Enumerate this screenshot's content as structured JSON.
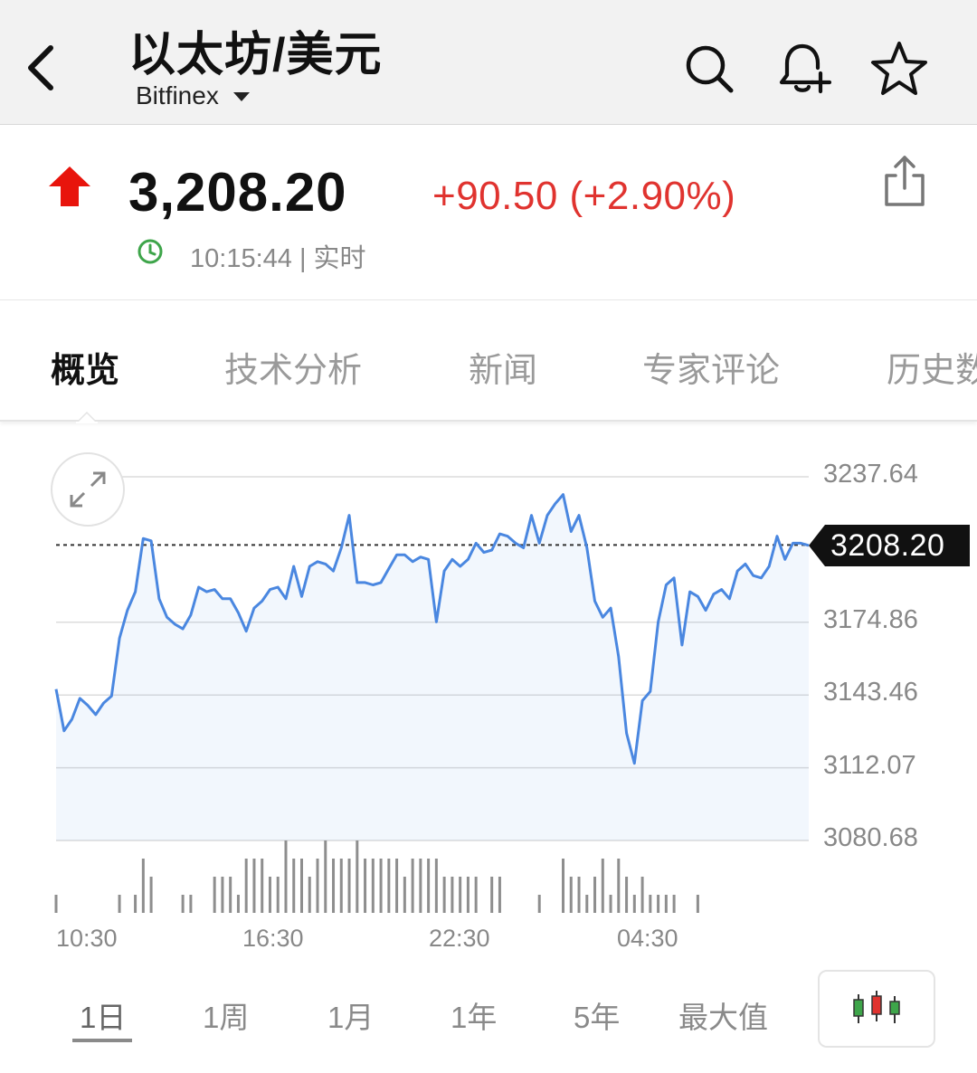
{
  "header": {
    "title": "以太坊/美元",
    "exchange": "Bitfinex",
    "icons": [
      "back-chevron-icon",
      "search-icon",
      "bell-plus-icon",
      "star-icon"
    ]
  },
  "quote": {
    "price": "3,208.20",
    "change": "+90.50 (+2.90%)",
    "time": "10:15:44 | 实时",
    "direction": "up",
    "up_color": "#e0332f",
    "clock_color": "#3ea54a"
  },
  "tabs": [
    "概览",
    "技术分析",
    "新闻",
    "专家评论",
    "历史数据"
  ],
  "chart": {
    "y_labels": [
      "3237.64",
      "3174.86",
      "3143.46",
      "3112.07",
      "3080.68"
    ],
    "x_labels": [
      "10:30",
      "16:30",
      "22:30",
      "04:30"
    ],
    "current_price_tag": "3208.20",
    "line_color": "#4a87e0"
  },
  "chart_data": {
    "type": "line",
    "x_ticks": [
      "10:30",
      "16:30",
      "22:30",
      "04:30"
    ],
    "ylim": [
      3080.68,
      3237.64
    ],
    "y_ticks": [
      3237.64,
      3206.25,
      3174.86,
      3143.46,
      3112.07,
      3080.68
    ],
    "current": 3208.2,
    "series": [
      {
        "values": [
          3146,
          3128,
          3133,
          3142,
          3139,
          3135,
          3140,
          3143,
          3168,
          3180,
          3188,
          3211,
          3210,
          3185,
          3177,
          3174,
          3172,
          3178,
          3190,
          3188,
          3189,
          3185,
          3185,
          3179,
          3171,
          3181,
          3184,
          3189,
          3190,
          3185,
          3199,
          3186,
          3199,
          3201,
          3200,
          3197,
          3207,
          3221,
          3192,
          3192,
          3191,
          3192,
          3198,
          3204,
          3204,
          3201,
          3203,
          3202,
          3175,
          3197,
          3202,
          3199,
          3202,
          3209,
          3205,
          3206,
          3213,
          3212,
          3209,
          3207,
          3221,
          3209,
          3221,
          3226,
          3230,
          3214,
          3221,
          3207,
          3184,
          3177,
          3181,
          3160,
          3127,
          3114,
          3141,
          3145,
          3175,
          3191,
          3194,
          3165,
          3188,
          3186,
          3180,
          3187,
          3189,
          3185,
          3197,
          3200,
          3195,
          3194,
          3199,
          3212,
          3202,
          3209,
          3209,
          3208
        ]
      }
    ],
    "volume": [
      1,
      0,
      0,
      0,
      0,
      0,
      0,
      0,
      1,
      0,
      1,
      3,
      2,
      0,
      0,
      0,
      1,
      1,
      0,
      0,
      2,
      2,
      2,
      1,
      3,
      3,
      3,
      2,
      2,
      4,
      3,
      3,
      2,
      3,
      4,
      3,
      3,
      3,
      4,
      3,
      3,
      3,
      3,
      3,
      2,
      3,
      3,
      3,
      3,
      2,
      2,
      2,
      2,
      2,
      0,
      2,
      2,
      0,
      0,
      0,
      0,
      1,
      0,
      0,
      3,
      2,
      2,
      1,
      2,
      3,
      1,
      3,
      2,
      1,
      2,
      1,
      1,
      1,
      1,
      0,
      0,
      1,
      0,
      0,
      0,
      0,
      0,
      0,
      0,
      0,
      0,
      0,
      0,
      0,
      0,
      0
    ]
  },
  "ranges": [
    "1日",
    "1周",
    "1月",
    "1年",
    "5年",
    "最大值"
  ],
  "selected_range": "1日"
}
